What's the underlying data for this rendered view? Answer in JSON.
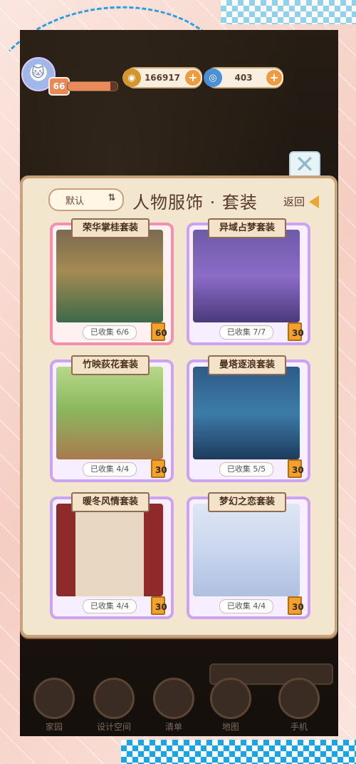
{
  "hud": {
    "level": "66",
    "xp_progress": 0.85,
    "gold": "166917",
    "gems": "403"
  },
  "panel": {
    "sort_label": "默认",
    "title": "人物服饰 · 套装",
    "back_label": "返回"
  },
  "outfits": [
    {
      "name": "荣华掌桂套装",
      "collected": "已收集 6/6",
      "count": "60"
    },
    {
      "name": "异域占梦套装",
      "collected": "已收集 7/7",
      "count": "30"
    },
    {
      "name": "竹映荻花套装",
      "collected": "已收集 4/4",
      "count": "30"
    },
    {
      "name": "曼塔逐浪套装",
      "collected": "已收集 5/5",
      "count": "30"
    },
    {
      "name": "暖冬风情套装",
      "collected": "已收集 4/4",
      "count": "30"
    },
    {
      "name": "梦幻之恋套装",
      "collected": "已收集 4/4",
      "count": "30"
    }
  ],
  "bottom_nav": {
    "home": "家园",
    "design": "设计空间",
    "menu": "清单",
    "map": "地图",
    "phone": "手机"
  },
  "colors": {
    "accent_orange": "#f0a432",
    "panel_bg": "#f3e6cf",
    "pink_frame": "#f48fae",
    "purple_frame": "#caa4f0"
  }
}
